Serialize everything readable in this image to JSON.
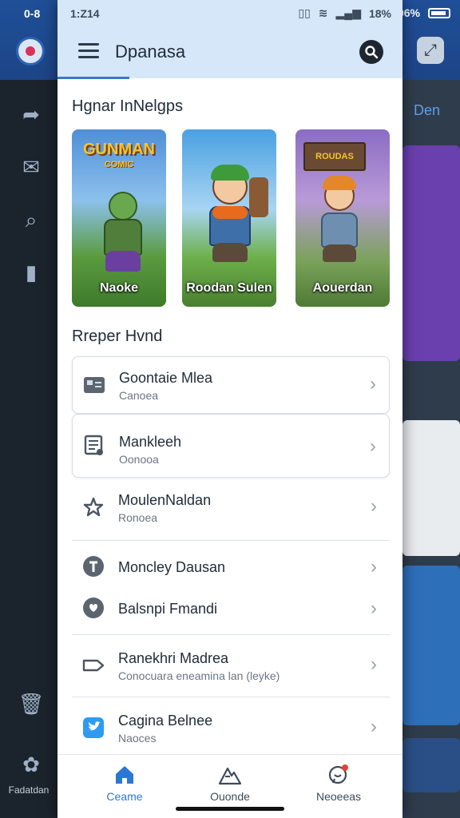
{
  "background_app": {
    "status_left": "0-8",
    "status_right_pct": "06%",
    "right_tab": "Den",
    "bottom_label": "Fadatdan"
  },
  "status_bar": {
    "time": "1:Z14",
    "battery": "18%"
  },
  "drawer": {
    "title": "Dpanasa",
    "featured_title": "Hgnar InNelgps",
    "games": [
      {
        "label": "Naoke",
        "banner": "GUNMAN",
        "banner_sub": "COMIC"
      },
      {
        "label": "Roodan Sulen"
      },
      {
        "label": "Aouerdan",
        "banner": "ROUDAS"
      }
    ],
    "list_title": "Rreper Hvnd",
    "items": [
      {
        "name": "Goontaie Mlea",
        "sub": "Canoea",
        "icon": "cabinet-icon"
      },
      {
        "name": "Mankleeh",
        "sub": "Oonooa",
        "icon": "document-icon"
      },
      {
        "name": "MoulenNaldan",
        "sub": "Ronoea",
        "icon": "star-icon"
      },
      {
        "name": "Moncley Dausan",
        "icon": "circle-t-icon"
      },
      {
        "name": "Balsnpi Fmandi",
        "icon": "heart-circle-icon"
      },
      {
        "name": "Ranekhri Madrea",
        "sub": "Conocuara eneamina lan (leyke)",
        "icon": "tag-icon"
      },
      {
        "name": "Cagina Belnee",
        "sub": "Naoces",
        "icon": "twitter-icon"
      }
    ],
    "nav": [
      {
        "label": "Ceame",
        "icon": "home-icon"
      },
      {
        "label": "Ouonde",
        "icon": "mountain-icon"
      },
      {
        "label": "Neoeeas",
        "icon": "chat-icon"
      }
    ]
  },
  "colors": {
    "accent": "#2b78d4",
    "header_bg": "#d6e7f9"
  }
}
